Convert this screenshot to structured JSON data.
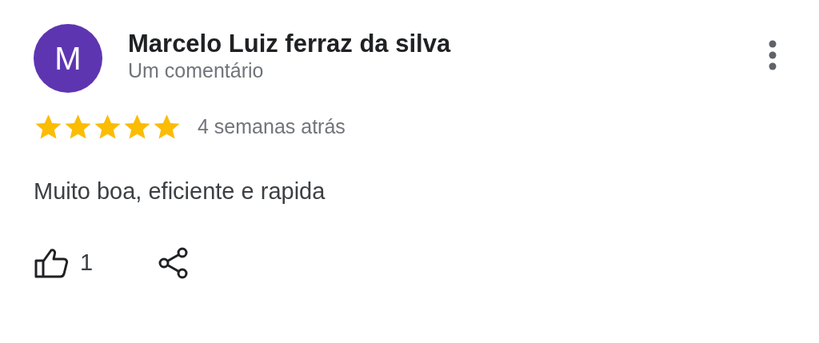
{
  "review": {
    "avatar_letter": "M",
    "author": "Marcelo Luiz ferraz da silva",
    "subtitle": "Um comentário",
    "stars": 5,
    "time": "4 semanas atrás",
    "text": "Muito boa, eficiente e rapida",
    "likes": "1"
  }
}
